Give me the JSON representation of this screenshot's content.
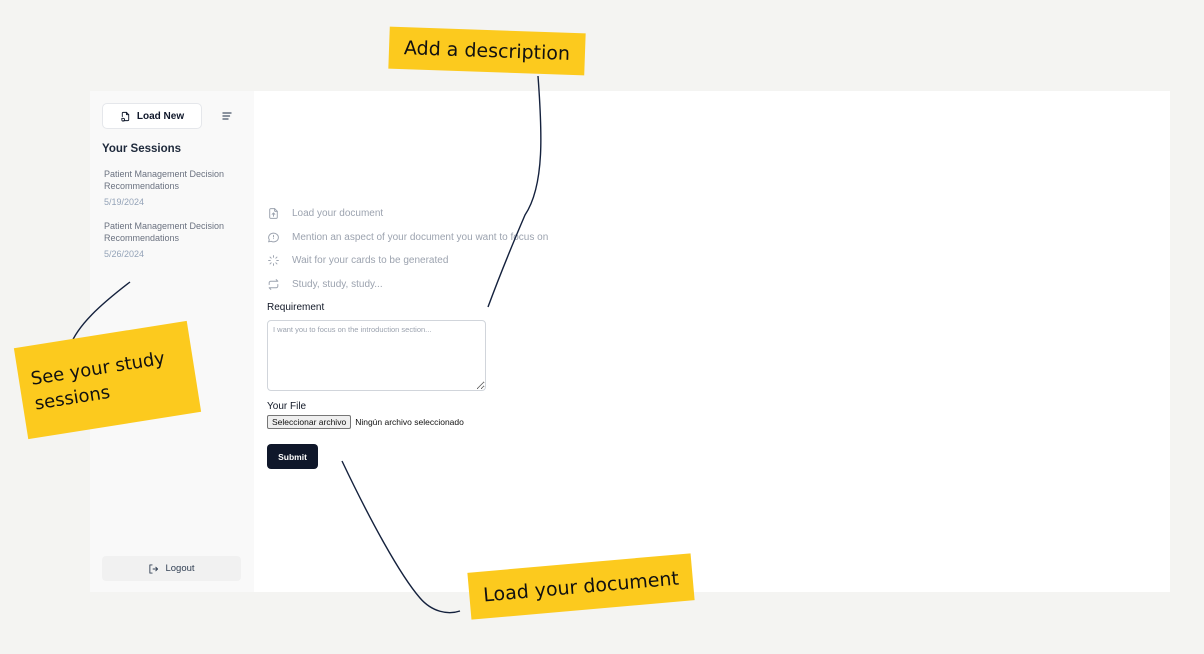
{
  "sidebar": {
    "load_new_label": "Load New",
    "sessions_title": "Your Sessions",
    "sessions": [
      {
        "title": "Patient Management Decision Recommendations",
        "date": "5/19/2024"
      },
      {
        "title": "Patient Management Decision Recommendations",
        "date": "5/26/2024"
      }
    ],
    "logout_label": "Logout"
  },
  "main": {
    "steps": [
      {
        "icon": "file-upload-icon",
        "label": "Load your document"
      },
      {
        "icon": "message-circle-icon",
        "label": "Mention an aspect of your document you want to focus on"
      },
      {
        "icon": "loader-icon",
        "label": "Wait for your cards to be generated"
      },
      {
        "icon": "repeat-icon",
        "label": "Study, study, study..."
      }
    ],
    "requirement_label": "Requirement",
    "requirement_placeholder": "I want you to focus on the introduction section...",
    "requirement_value": "",
    "file_label": "Your File",
    "file_button_label": "Seleccionar archivo",
    "file_status": "Ningún archivo seleccionado",
    "submit_label": "Submit"
  },
  "annotations": {
    "description_note": "Add a description",
    "sessions_note_line1": "See your study",
    "sessions_note_line2": "sessions",
    "document_note": "Load your document",
    "note_color": "#fcca1e"
  },
  "colors": {
    "page_background": "#f4f4f2",
    "sidebar_background": "#f9f9f9",
    "primary_dark": "#0f172a",
    "muted_text": "#9ca3af"
  }
}
